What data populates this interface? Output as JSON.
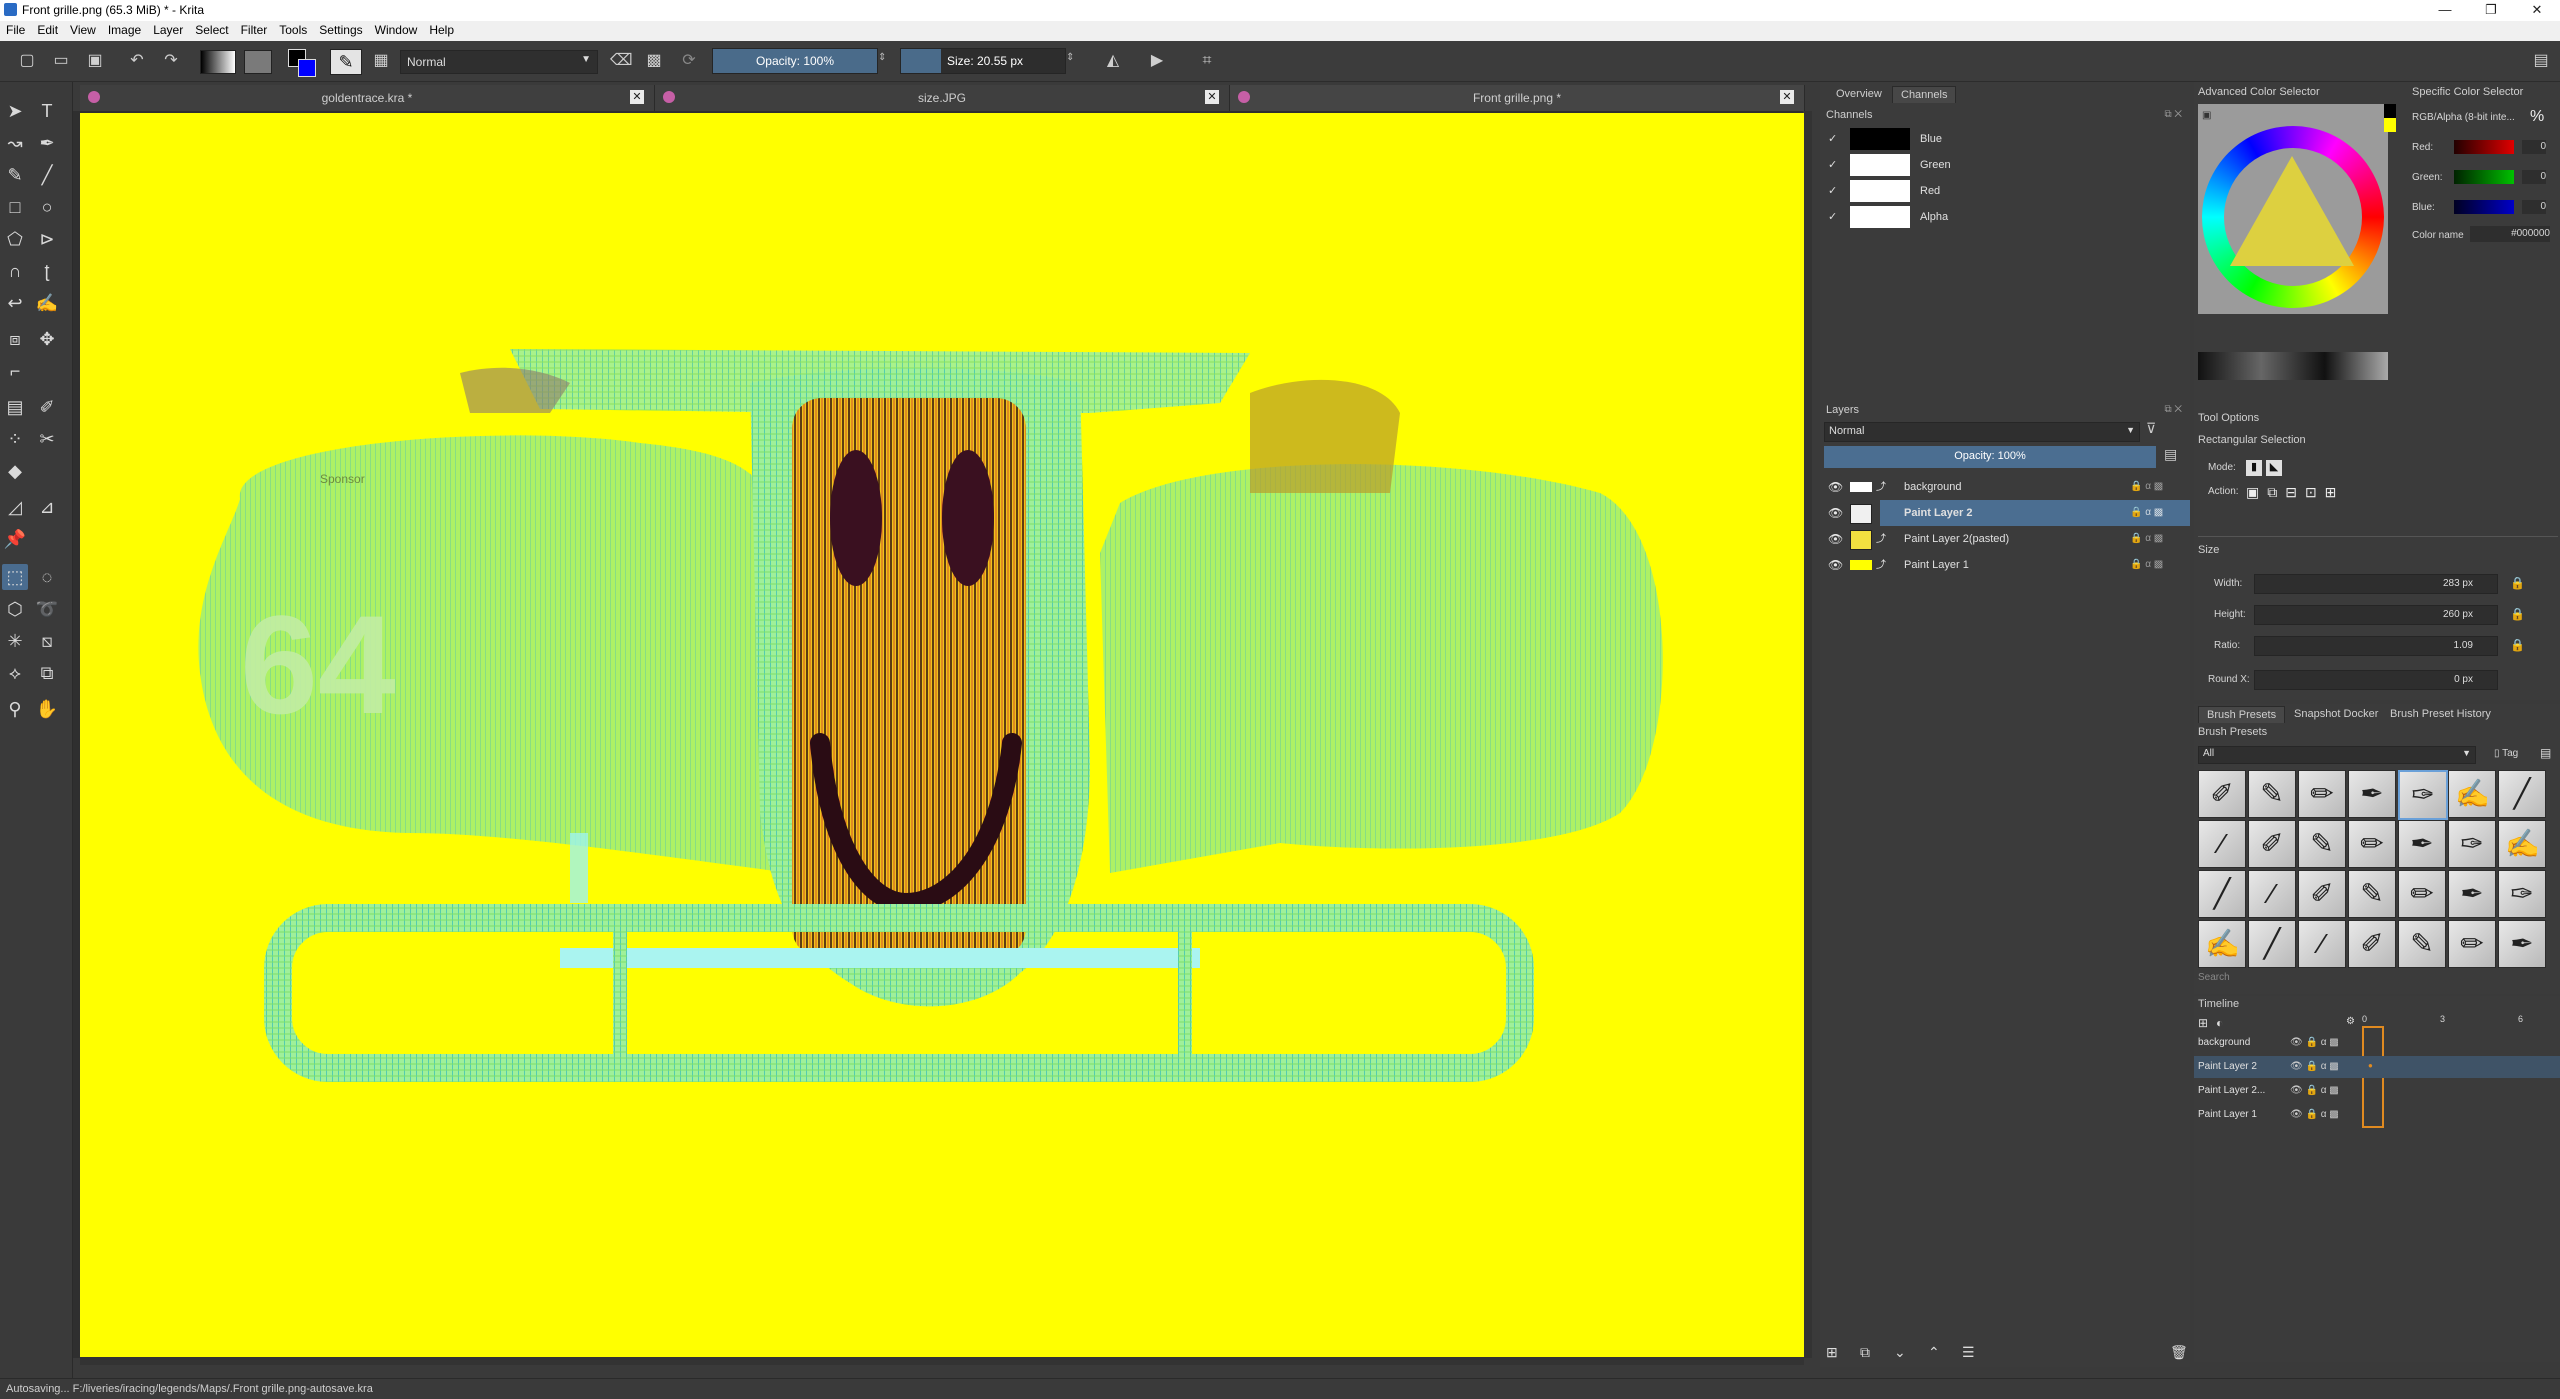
{
  "window": {
    "title": "Front grille.png (65.3 MiB)  * - Krita",
    "minimize": "—",
    "maximize": "❐",
    "close": "✕"
  },
  "menu": [
    "File",
    "Edit",
    "View",
    "Image",
    "Layer",
    "Select",
    "Filter",
    "Tools",
    "Settings",
    "Window",
    "Help"
  ],
  "toolbar": {
    "blend_mode": "Normal",
    "opacity_label": "Opacity: 100%",
    "opacity_value": 1.0,
    "size_label": "Size: 20.55 px"
  },
  "tabs": [
    {
      "name": "goldentrace.kra *"
    },
    {
      "name": "size.JPG"
    },
    {
      "name": "Front grille.png *"
    }
  ],
  "canvas": {
    "number_text": "64",
    "small_text": "Sponsor"
  },
  "overview_dock": {
    "tabs": [
      "Overview",
      "Channels"
    ],
    "title": "Channels",
    "channels": [
      {
        "name": "Blue",
        "checked": "✓"
      },
      {
        "name": "Green",
        "checked": "✓"
      },
      {
        "name": "Red",
        "checked": "✓"
      },
      {
        "name": "Alpha",
        "checked": "✓"
      }
    ]
  },
  "layers_dock": {
    "title": "Layers",
    "blend_mode": "Normal",
    "opacity_label": "Opacity: 100%",
    "layers": [
      {
        "name": "background"
      },
      {
        "name": "Paint Layer 2"
      },
      {
        "name": "Paint Layer 2(pasted)"
      },
      {
        "name": "Paint Layer 1"
      }
    ]
  },
  "color_dock": {
    "advanced_title": "Advanced Color Selector",
    "specific_title": "Specific Color Selector",
    "color_space": "RGB/Alpha (8-bit inte...",
    "red_label": "Red:",
    "green_label": "Green:",
    "blue_label": "Blue:",
    "red_value": "0",
    "green_value": "0",
    "blue_value": "0",
    "color_name_label": "Color name",
    "color_name_value": "#000000",
    "percent_icon": "%"
  },
  "tool_options": {
    "title": "Tool Options",
    "subtitle": "Rectangular Selection",
    "mode_label": "Mode:",
    "action_label": "Action:",
    "size_section": "Size",
    "width_label": "Width:",
    "width_value": "283 px",
    "height_label": "Height:",
    "height_value": "260 px",
    "ratio_label": "Ratio:",
    "ratio_value": "1.09",
    "round_label": "Round X:",
    "round_value": "0 px"
  },
  "brush_dock": {
    "tabs": [
      "Brush Presets",
      "Snapshot Docker",
      "Brush Preset History"
    ],
    "title": "Brush Presets",
    "filter": "All",
    "tag_label": "Tag",
    "search_placeholder": "Search"
  },
  "timeline": {
    "title": "Timeline",
    "frames": [
      "0",
      "3",
      "6"
    ],
    "layers": [
      {
        "name": "background"
      },
      {
        "name": "Paint Layer 2"
      },
      {
        "name": "Paint Layer 2..."
      },
      {
        "name": "Paint Layer 1"
      }
    ]
  },
  "status": {
    "text": "Autosaving... F:/liveries/iracing/legends/Maps/.Front grille.png-autosave.kra"
  },
  "colors": {
    "accent": "#4b6e91",
    "canvas_bg": "#ffff00",
    "panel_bg": "#3b3b3b"
  }
}
